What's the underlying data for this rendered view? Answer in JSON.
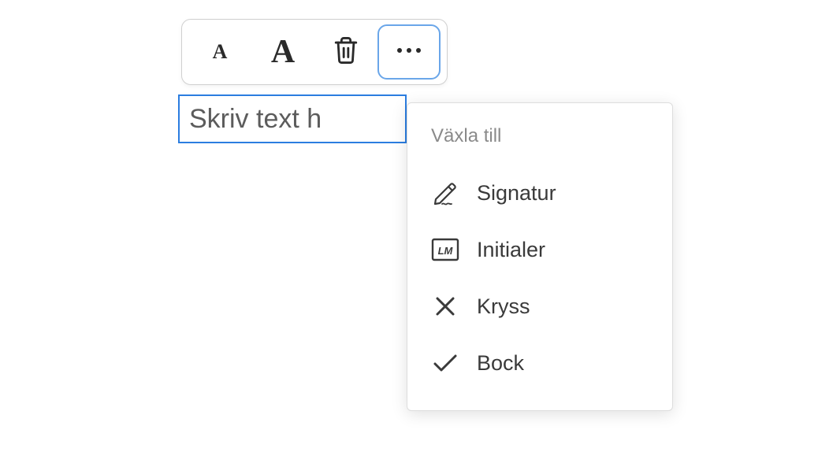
{
  "toolbar": {
    "small_text_label": "A",
    "large_text_label": "A"
  },
  "text_field": {
    "placeholder": "Skriv text h"
  },
  "menu": {
    "header": "Växla till",
    "items": [
      {
        "icon": "signature-icon",
        "label": "Signatur"
      },
      {
        "icon": "initials-icon",
        "label": "Initialer"
      },
      {
        "icon": "cross-icon",
        "label": "Kryss"
      },
      {
        "icon": "check-icon",
        "label": "Bock"
      }
    ],
    "initials_text": "LM"
  }
}
